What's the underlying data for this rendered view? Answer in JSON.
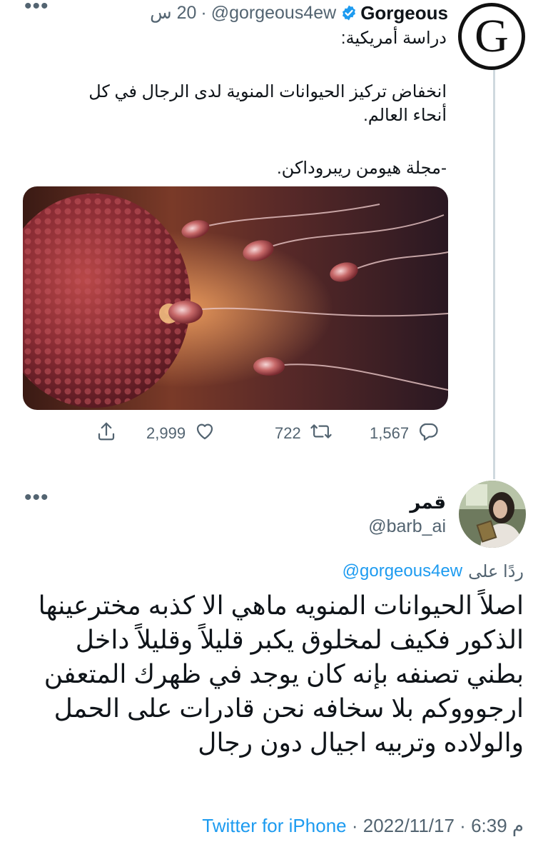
{
  "tweet": {
    "author_name": "Gorgeous",
    "author_handle": "@gorgeous4ew",
    "separator": "·",
    "time_ago": "20 س",
    "more": "•••",
    "avatar_letter": "G",
    "line_study": "دراسة أمريكية:",
    "line_headline": "انخفاض تركيز الحيوانات المنوية لدى الرجال في كل أنحاء العالم.",
    "line_journal": "-مجلة هيومن ريبروداكن.",
    "media_icon": "sperm-egg-image",
    "stats": {
      "replies": "1,567",
      "retweets": "722",
      "likes": "2,999"
    }
  },
  "reply": {
    "author_name": "قمر",
    "author_handle": "@barb_ai",
    "more": "•••",
    "replying_label": "ردًا على",
    "replying_to": "@gorgeous4ew",
    "text": "اصلاً الحيوانات المنويه ماهي الا كذبه مخترعينها الذكور فكيف لمخلوق يكبر قليلاً وقليلاً داخل بطني تصنفه بإنه كان يوجد في ظهرك المتعفن ارجوووكم بلا سخافه نحن قادرات على الحمل والولاده وتربيه اجيال دون رجال",
    "footer_time": "م 6:39",
    "footer_date": "2022/11/17",
    "footer_source": "Twitter for iPhone"
  },
  "colors": {
    "text": "#0f1419",
    "secondary": "#536471",
    "link": "#1d9bf0",
    "verified": "#1d9bf0",
    "thread_line": "#cfd9de"
  }
}
